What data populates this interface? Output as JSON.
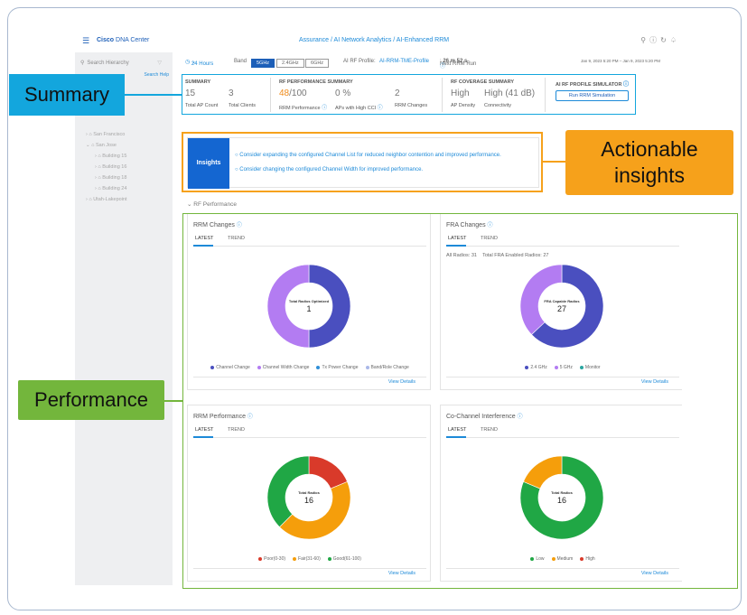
{
  "header": {
    "app_name_bold": "Cisco",
    "app_name_rest": "DNA Center",
    "breadcrumb": "Assurance / AI Network Analytics / AI-Enhanced RRM",
    "icons": [
      "search-icon",
      "help-icon",
      "refresh-icon",
      "notification-icon"
    ]
  },
  "sidebar": {
    "search_placeholder": "Search Hierarchy",
    "help_link": "Search Help",
    "items": [
      {
        "label": "San Francisco",
        "depth": 0
      },
      {
        "label": "San Jose",
        "depth": 0
      },
      {
        "label": "Building 15",
        "depth": 1
      },
      {
        "label": "Building 16",
        "depth": 1
      },
      {
        "label": "Building 18",
        "depth": 1
      },
      {
        "label": "Building 24",
        "depth": 1
      },
      {
        "label": "Utah-Lakepoint",
        "depth": 0
      }
    ]
  },
  "controls": {
    "time_range": "24 Hours",
    "band_label": "Band",
    "bands": [
      "5GHz",
      "2.4GHz",
      "6GHz"
    ],
    "active_band": "5GHz",
    "profile_label": "AI RF Profile:",
    "profile_value": "AI-RRM-TME-Profile",
    "next_run_label": "Next RRM Run",
    "next_run_value": "26 m 52 s",
    "date_range": "Jan 9, 2023 5:20 PM – Jan 9, 2023 5:20 PM"
  },
  "summary": {
    "heading": "SUMMARY",
    "ap_count": "15",
    "ap_count_label": "Total AP Count",
    "clients": "3",
    "clients_label": "Total Clients",
    "rf_heading": "RF PERFORMANCE SUMMARY",
    "rrm_perf": "48",
    "rrm_perf_suffix": "/100",
    "rrm_perf_label": "RRM Performance",
    "cci": "0 %",
    "cci_label": "APs with High CCI",
    "rrm_changes": "2",
    "rrm_changes_label": "RRM Changes",
    "coverage_heading": "RF COVERAGE SUMMARY",
    "ap_density": "High",
    "ap_density_label": "AP Density",
    "connectivity": "High (41 dB)",
    "connectivity_label": "Connectivity",
    "simulator_heading": "AI RF PROFILE SIMULATOR",
    "simulator_button": "Run RRM Simulation"
  },
  "insights": {
    "tag": "Insights",
    "items": [
      "Consider expanding the configured Channel List for reduced neighbor contention and improved performance.",
      "Consider changing the configured Channel Width for improved performance."
    ]
  },
  "rf_performance_label": "RF Performance",
  "tabs": {
    "latest": "LATEST",
    "trend": "TREND"
  },
  "view_details": "View Details",
  "cards": {
    "rrm_changes": {
      "title": "RRM Changes",
      "center_label": "Total Radios Optimized",
      "center_value": "1"
    },
    "fra_changes": {
      "title": "FRA Changes",
      "meta_all": "All Radios: 31",
      "meta_fra": "Total FRA Enabled Radios: 27",
      "center_label": "FRA Capable Radios",
      "center_value": "27"
    },
    "rrm_performance": {
      "title": "RRM Performance",
      "center_label": "Total Radios",
      "center_value": "16"
    },
    "cci": {
      "title": "Co-Channel Interference",
      "center_label": "Total Radios",
      "center_value": "16"
    }
  },
  "chart_data": [
    {
      "type": "pie",
      "title": "RRM Changes",
      "categories": [
        "Channel Change",
        "Channel Width Change",
        "Tx Power Change",
        "Band/Role Change"
      ],
      "values": [
        50,
        50,
        0,
        0
      ],
      "colors": [
        "#4a4fbf",
        "#b37cf2",
        "#2f8fd8",
        "#aab8e8"
      ]
    },
    {
      "type": "pie",
      "title": "FRA Changes",
      "categories": [
        "2.4 GHz",
        "5 GHz",
        "Monitor"
      ],
      "values": [
        63,
        37,
        0
      ],
      "colors": [
        "#4a4fbf",
        "#b37cf2",
        "#2aa6a0"
      ]
    },
    {
      "type": "pie",
      "title": "RRM Performance",
      "categories": [
        "Poor(0-30)",
        "Fair(31-60)",
        "Good(61-100)"
      ],
      "values": [
        3,
        7,
        6
      ],
      "colors": [
        "#d93a2a",
        "#f59e0b",
        "#20a745"
      ]
    },
    {
      "type": "pie",
      "title": "Co-Channel Interference",
      "categories": [
        "Low",
        "Medium",
        "High"
      ],
      "values": [
        13,
        3,
        0
      ],
      "colors": [
        "#20a745",
        "#f59e0b",
        "#d93a2a"
      ]
    }
  ],
  "callouts": {
    "summary": "Summary",
    "insights_line1": "Actionable",
    "insights_line2": "insights",
    "performance": "Performance"
  },
  "colors": {
    "callout_summary": "#13a6dd",
    "callout_insights": "#f6a11b",
    "callout_performance": "#73b63c",
    "brand": "#1d5fb8"
  }
}
